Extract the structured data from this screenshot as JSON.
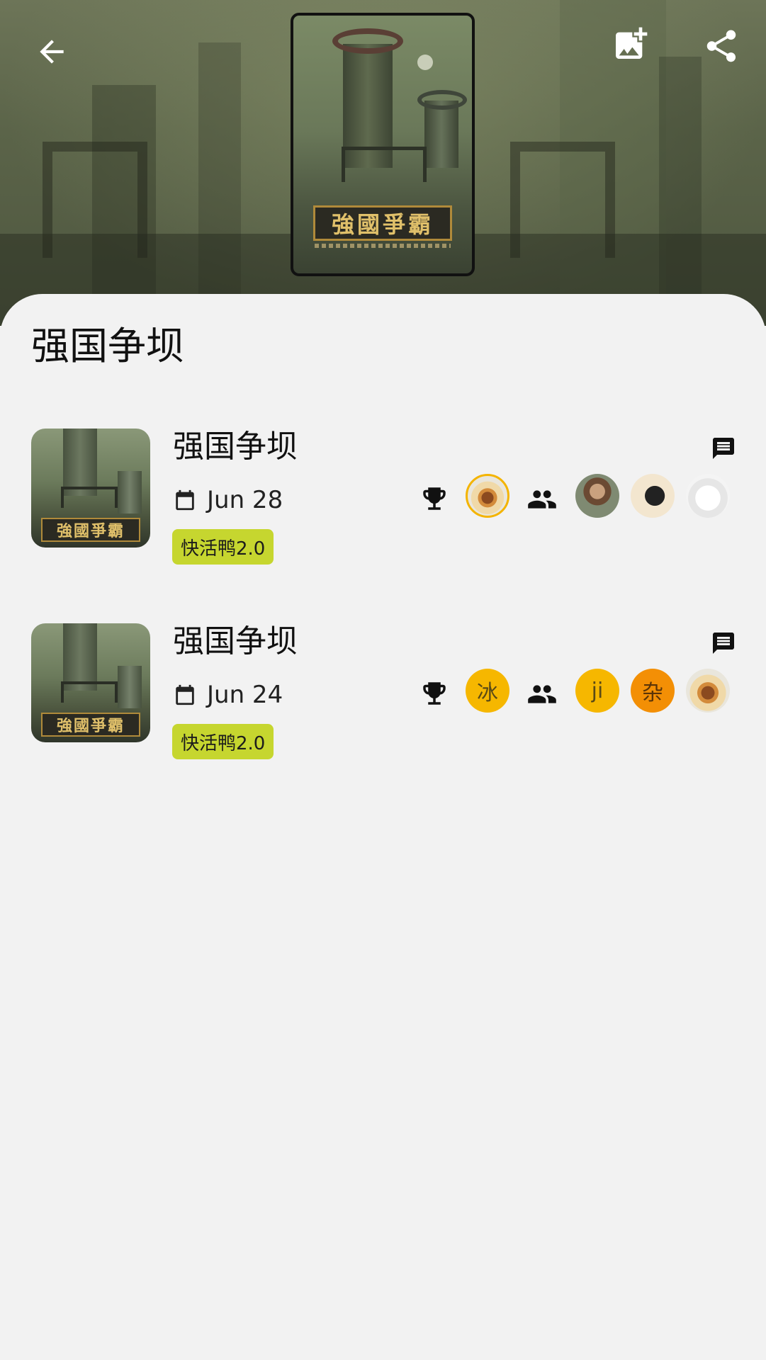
{
  "header": {
    "cover_logo_text": "強國爭霸"
  },
  "page": {
    "title": "强国争坝"
  },
  "colors": {
    "tag_background": "#c6d62f",
    "winner_ring": "#f4b400",
    "avatar_yellow": "#f6b700",
    "avatar_orange": "#f38f05"
  },
  "sessions": [
    {
      "title": "强国争坝",
      "thumb_logo": "強國爭霸",
      "date": "Jun 28",
      "tag": "快活鸭2.0",
      "winners": [
        {
          "type": "image",
          "icon": "burger-avatar"
        }
      ],
      "players": [
        {
          "type": "image",
          "icon": "man-avatar"
        },
        {
          "type": "image",
          "icon": "bull-avatar"
        },
        {
          "type": "image",
          "icon": "cat-avatar"
        }
      ]
    },
    {
      "title": "强国争坝",
      "thumb_logo": "強國爭霸",
      "date": "Jun 24",
      "tag": "快活鸭2.0",
      "winners": [
        {
          "type": "text",
          "label": "冰"
        }
      ],
      "players": [
        {
          "type": "text",
          "label": "ji"
        },
        {
          "type": "text",
          "label": "杂"
        },
        {
          "type": "image",
          "icon": "burger-avatar"
        }
      ]
    }
  ]
}
